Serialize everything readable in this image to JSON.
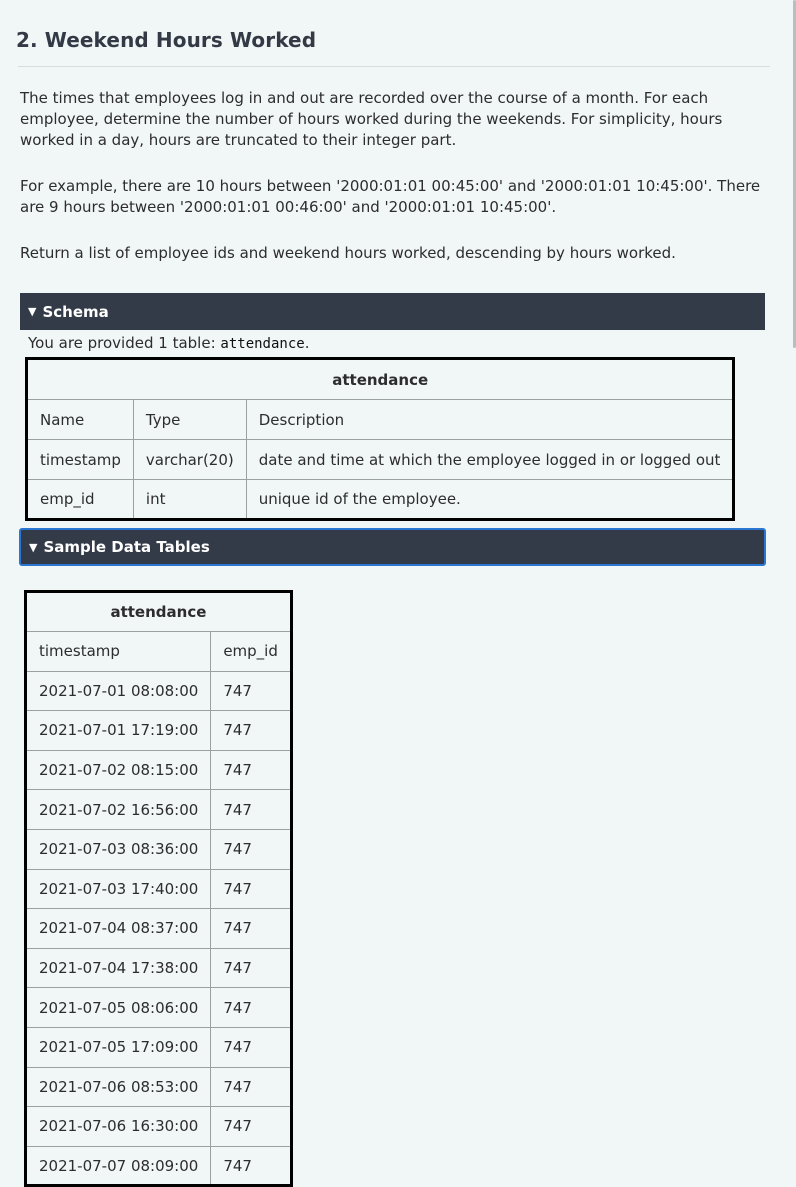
{
  "title": "2. Weekend Hours Worked",
  "description": {
    "p1": "The times that employees log in and out are recorded over the course of a month. For each employee, determine the number of hours worked during the weekends. For simplicity, hours worked in a day, hours are truncated to their integer part.",
    "p2": "For example, there are 10 hours between '2000:01:01 00:45:00' and '2000:01:01 10:45:00'. There are 9 hours between '2000:01:01 00:46:00' and '2000:01:01 10:45:00'.",
    "p3": "Return a list of employee ids and weekend hours worked, descending by hours worked."
  },
  "schema": {
    "toggle": "▼",
    "label": "Schema",
    "provided_prefix": "You are provided 1 table: ",
    "provided_table": "attendance",
    "provided_suffix": ".",
    "table": {
      "caption": "attendance",
      "headers": [
        "Name",
        "Type",
        "Description"
      ],
      "rows": [
        [
          "timestamp",
          "varchar(20)",
          "date and time at which the employee logged in or logged out"
        ],
        [
          "emp_id",
          "int",
          "unique id of the employee."
        ]
      ]
    }
  },
  "sample": {
    "toggle": "▼",
    "label": "Sample Data Tables",
    "table": {
      "caption": "attendance",
      "headers": [
        "timestamp",
        "emp_id"
      ],
      "rows": [
        [
          "2021-07-01 08:08:00",
          "747"
        ],
        [
          "2021-07-01 17:19:00",
          "747"
        ],
        [
          "2021-07-02 08:15:00",
          "747"
        ],
        [
          "2021-07-02 16:56:00",
          "747"
        ],
        [
          "2021-07-03 08:36:00",
          "747"
        ],
        [
          "2021-07-03 17:40:00",
          "747"
        ],
        [
          "2021-07-04 08:37:00",
          "747"
        ],
        [
          "2021-07-04 17:38:00",
          "747"
        ],
        [
          "2021-07-05 08:06:00",
          "747"
        ],
        [
          "2021-07-05 17:09:00",
          "747"
        ],
        [
          "2021-07-06 08:53:00",
          "747"
        ],
        [
          "2021-07-06 16:30:00",
          "747"
        ],
        [
          "2021-07-07 08:09:00",
          "747"
        ]
      ]
    }
  },
  "colors": {
    "background": "#f1f6f6",
    "section_bar": "#343b48",
    "focus_outline": "#2a76d2"
  }
}
